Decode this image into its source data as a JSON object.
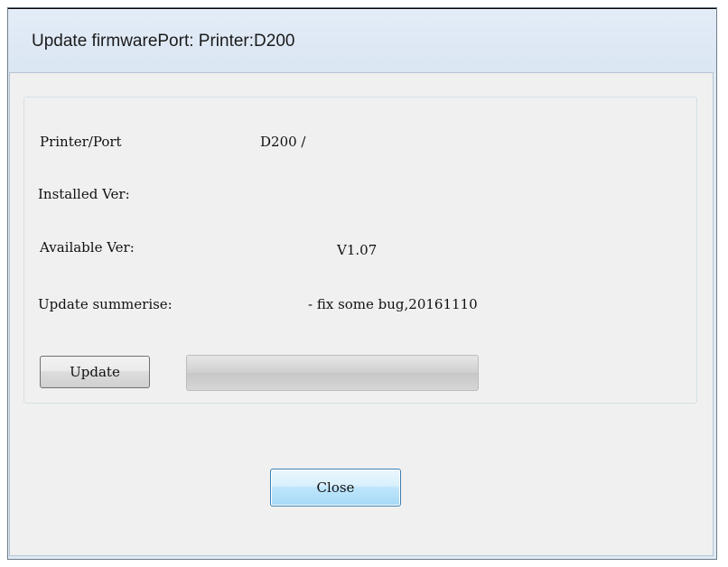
{
  "window": {
    "title": "Update firmwarePort:  Printer:D200"
  },
  "info": {
    "printer_port_label": "Printer/Port",
    "printer_port_value": "D200 /",
    "installed_label": "Installed Ver:",
    "installed_value": "",
    "available_label": "Available Ver:",
    "available_value": "V1.07",
    "summary_label": "Update summerise:",
    "summary_value": "- fix some bug,20161110"
  },
  "actions": {
    "update_label": "Update",
    "close_label": "Close"
  },
  "progress": {
    "value_percent": 0
  }
}
